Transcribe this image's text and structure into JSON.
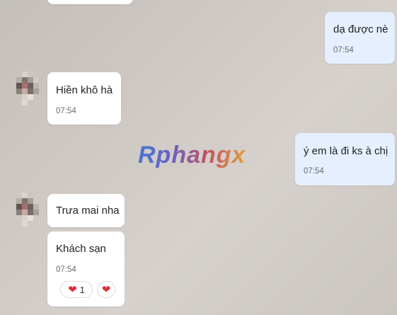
{
  "messages": [
    {
      "id": "m1",
      "text": "dạ được nè",
      "time": "07:54"
    },
    {
      "id": "m2",
      "text": "Hiền khô hà",
      "time": "07:54"
    },
    {
      "id": "m3",
      "text": "ý em là đi ks à chị",
      "time": "07:54"
    },
    {
      "id": "m4",
      "text": "Trưa mai nha"
    },
    {
      "id": "m5",
      "text": "Khách sạn",
      "time": "07:54"
    }
  ],
  "reactions": {
    "count": "1"
  },
  "watermark": "Rphangx",
  "colors": {
    "incoming_bubble": "#ffffff",
    "outgoing_bubble": "#e5efff",
    "heart": "#e0303a"
  }
}
